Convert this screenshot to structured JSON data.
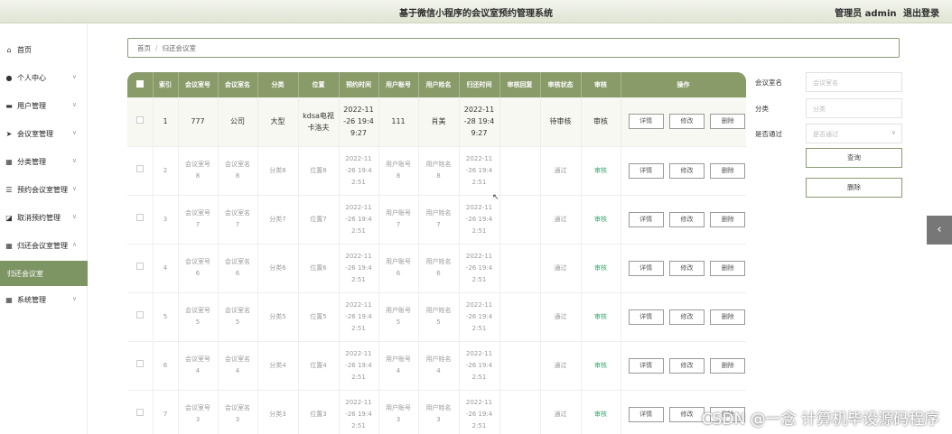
{
  "header": {
    "title": "基于微信小程序的会议室预约管理系统",
    "user": "管理员 admin",
    "logout": "退出登录"
  },
  "sidebar": {
    "items": [
      {
        "label": "首页",
        "icon": "home-icon"
      },
      {
        "label": "个人中心",
        "icon": "person-icon"
      },
      {
        "label": "用户管理",
        "icon": "users-icon"
      },
      {
        "label": "会议室管理",
        "icon": "send-icon"
      },
      {
        "label": "分类管理",
        "icon": "grid-icon"
      },
      {
        "label": "预约会议室管理",
        "icon": "sliders-icon"
      },
      {
        "label": "取消预约管理",
        "icon": "cancel-icon"
      },
      {
        "label": "归还会议室管理",
        "icon": "grid-icon"
      },
      {
        "label": "系统管理",
        "icon": "grid-icon"
      }
    ],
    "active_sub": "归还会议室"
  },
  "breadcrumb": {
    "home": "首页",
    "current": "归还会议室"
  },
  "table": {
    "headers": [
      "索引",
      "会议室号",
      "会议室名",
      "分类",
      "位置",
      "预约时间",
      "用户账号",
      "用户姓名",
      "归还时间",
      "审核回复",
      "审核状态",
      "审核",
      "操作"
    ],
    "ops": {
      "detail": "详情",
      "edit": "修改",
      "delete": "删除"
    },
    "rows": [
      {
        "idx": "1",
        "room_no": "777",
        "room_name": "公司",
        "category": "大型",
        "location": "kdsa电视\n卡洛夫",
        "booked": "2022-11\n-26 19:4\n9:27",
        "account": "111",
        "name": "肖美",
        "returned": "2022-11\n-28 19:4\n9:27",
        "reply": "",
        "status": "待审核",
        "audit": "审核"
      },
      {
        "idx": "2",
        "room_no": "会议室号\n8",
        "room_name": "会议室名\n8",
        "category": "分类8",
        "location": "位置8",
        "booked": "2022-11\n-26 19:4\n2:51",
        "account": "用户账号\n8",
        "name": "用户姓名\n8",
        "returned": "2022-11\n-26 19:4\n2:51",
        "reply": "",
        "status": "通过",
        "audit": "审核"
      },
      {
        "idx": "3",
        "room_no": "会议室号\n7",
        "room_name": "会议室名\n7",
        "category": "分类7",
        "location": "位置7",
        "booked": "2022-11\n-26 19:4\n2:51",
        "account": "用户账号\n7",
        "name": "用户姓名\n7",
        "returned": "2022-11\n-26 19:4\n2:51",
        "reply": "",
        "status": "通过",
        "audit": "审核"
      },
      {
        "idx": "4",
        "room_no": "会议室号\n6",
        "room_name": "会议室名\n6",
        "category": "分类6",
        "location": "位置6",
        "booked": "2022-11\n-26 19:4\n2:51",
        "account": "用户账号\n6",
        "name": "用户姓名\n6",
        "returned": "2022-11\n-26 19:4\n2:51",
        "reply": "",
        "status": "通过",
        "audit": "审核"
      },
      {
        "idx": "5",
        "room_no": "会议室号\n5",
        "room_name": "会议室名\n5",
        "category": "分类5",
        "location": "位置5",
        "booked": "2022-11\n-26 19:4\n2:51",
        "account": "用户账号\n5",
        "name": "用户姓名\n5",
        "returned": "2022-11\n-26 19:4\n2:51",
        "reply": "",
        "status": "通过",
        "audit": "审核"
      },
      {
        "idx": "6",
        "room_no": "会议室号\n4",
        "room_name": "会议室名\n4",
        "category": "分类4",
        "location": "位置4",
        "booked": "2022-11\n-26 19:4\n2:51",
        "account": "用户账号\n4",
        "name": "用户姓名\n4",
        "returned": "2022-11\n-26 19:4\n2:51",
        "reply": "",
        "status": "通过",
        "audit": "审核"
      },
      {
        "idx": "7",
        "room_no": "会议室号\n3",
        "room_name": "会议室名\n3",
        "category": "分类3",
        "location": "位置3",
        "booked": "2022-11\n-26 19:4\n2:51",
        "account": "用户账号\n3",
        "name": "用户姓名\n3",
        "returned": "2022-11\n-26 19:4\n2:51",
        "reply": "",
        "status": "通过",
        "audit": "审核"
      }
    ]
  },
  "filter": {
    "room_name_label": "会议室名",
    "room_name_placeholder": "会议室名",
    "category_label": "分类",
    "category_placeholder": "分类",
    "passed_label": "是否通过",
    "passed_placeholder": "是否通过",
    "search_button": "查询",
    "delete_button": "删除"
  },
  "watermark": "CSDN @一念 计算机毕设源码程序",
  "colors": {
    "accent": "#8a9b6a",
    "active_menu": "#7d9463",
    "audit_link": "#3aa56d"
  }
}
